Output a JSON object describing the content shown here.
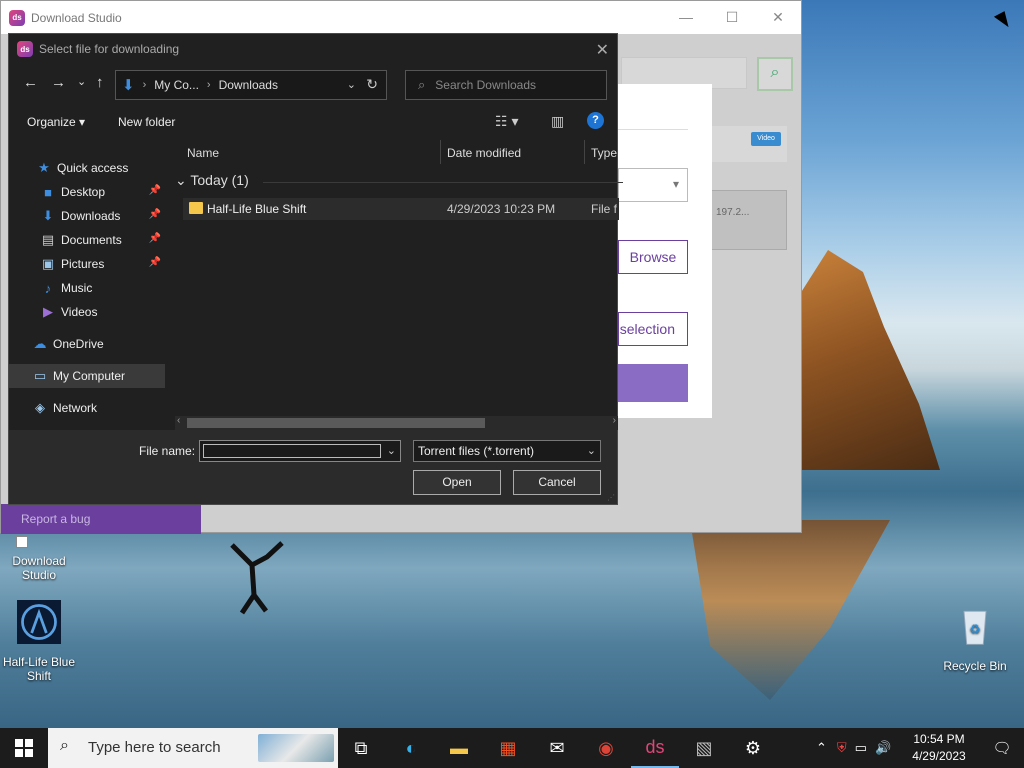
{
  "bg_window": {
    "title": "Download Studio",
    "minimize": "—",
    "maximize": "☐",
    "close": "✕",
    "report_bug": "Report a bug",
    "panel_text": "197.2...",
    "badge": "Video",
    "browse_label": "Browse",
    "selection_label": "selection"
  },
  "dialog": {
    "title": "Select file for downloading",
    "close": "✕",
    "nav": {
      "back": "←",
      "forward": "→",
      "recent": "⌄",
      "up": "↑"
    },
    "address": {
      "segments": [
        "My Co...",
        "Downloads"
      ],
      "sep": "›",
      "refresh": "↻",
      "dropdown": "⌄"
    },
    "search_placeholder": "Search Downloads",
    "toolbar": {
      "organize": "Organize ▾",
      "new_folder": "New folder",
      "help": "?"
    },
    "nav_pane": [
      {
        "label": "Quick access",
        "icon": "star-icon",
        "glyph": "★",
        "pinned": false
      },
      {
        "label": "Desktop",
        "icon": "desktop-icon",
        "glyph": "■",
        "pinned": true
      },
      {
        "label": "Downloads",
        "icon": "download-icon",
        "glyph": "⬇",
        "pinned": true
      },
      {
        "label": "Documents",
        "icon": "documents-icon",
        "glyph": "▤",
        "pinned": true
      },
      {
        "label": "Pictures",
        "icon": "pictures-icon",
        "glyph": "▣",
        "pinned": true
      },
      {
        "label": "Music",
        "icon": "music-icon",
        "glyph": "♪",
        "pinned": false
      },
      {
        "label": "Videos",
        "icon": "videos-icon",
        "glyph": "▶",
        "pinned": false
      },
      {
        "label": "OneDrive",
        "icon": "cloud-icon",
        "glyph": "☁",
        "pinned": false
      },
      {
        "label": "My Computer",
        "icon": "computer-icon",
        "glyph": "▭",
        "pinned": false
      },
      {
        "label": "Network",
        "icon": "network-icon",
        "glyph": "◈",
        "pinned": false
      }
    ],
    "pin_glyph": "📌",
    "columns": {
      "name": "Name",
      "date": "Date modified",
      "type": "Type"
    },
    "group": "Today (1)",
    "files": [
      {
        "name": "Half-Life Blue Shift",
        "date": "4/29/2023 10:23 PM",
        "type": "File f"
      }
    ],
    "file_name_label": "File name:",
    "file_name_value": "",
    "file_type": "Torrent files (*.torrent)",
    "open": "Open",
    "cancel": "Cancel"
  },
  "desktop_icons": [
    {
      "label": "Download Studio"
    },
    {
      "label": "Half-Life Blue Shift"
    },
    {
      "label": "Recycle Bin"
    }
  ],
  "taskbar": {
    "search_placeholder": "Type here to search",
    "time": "10:54 PM",
    "date": "4/29/2023",
    "apps": [
      "task-view",
      "edge",
      "file-explorer",
      "store",
      "mail",
      "chrome",
      "download-studio",
      "photos",
      "settings"
    ]
  }
}
